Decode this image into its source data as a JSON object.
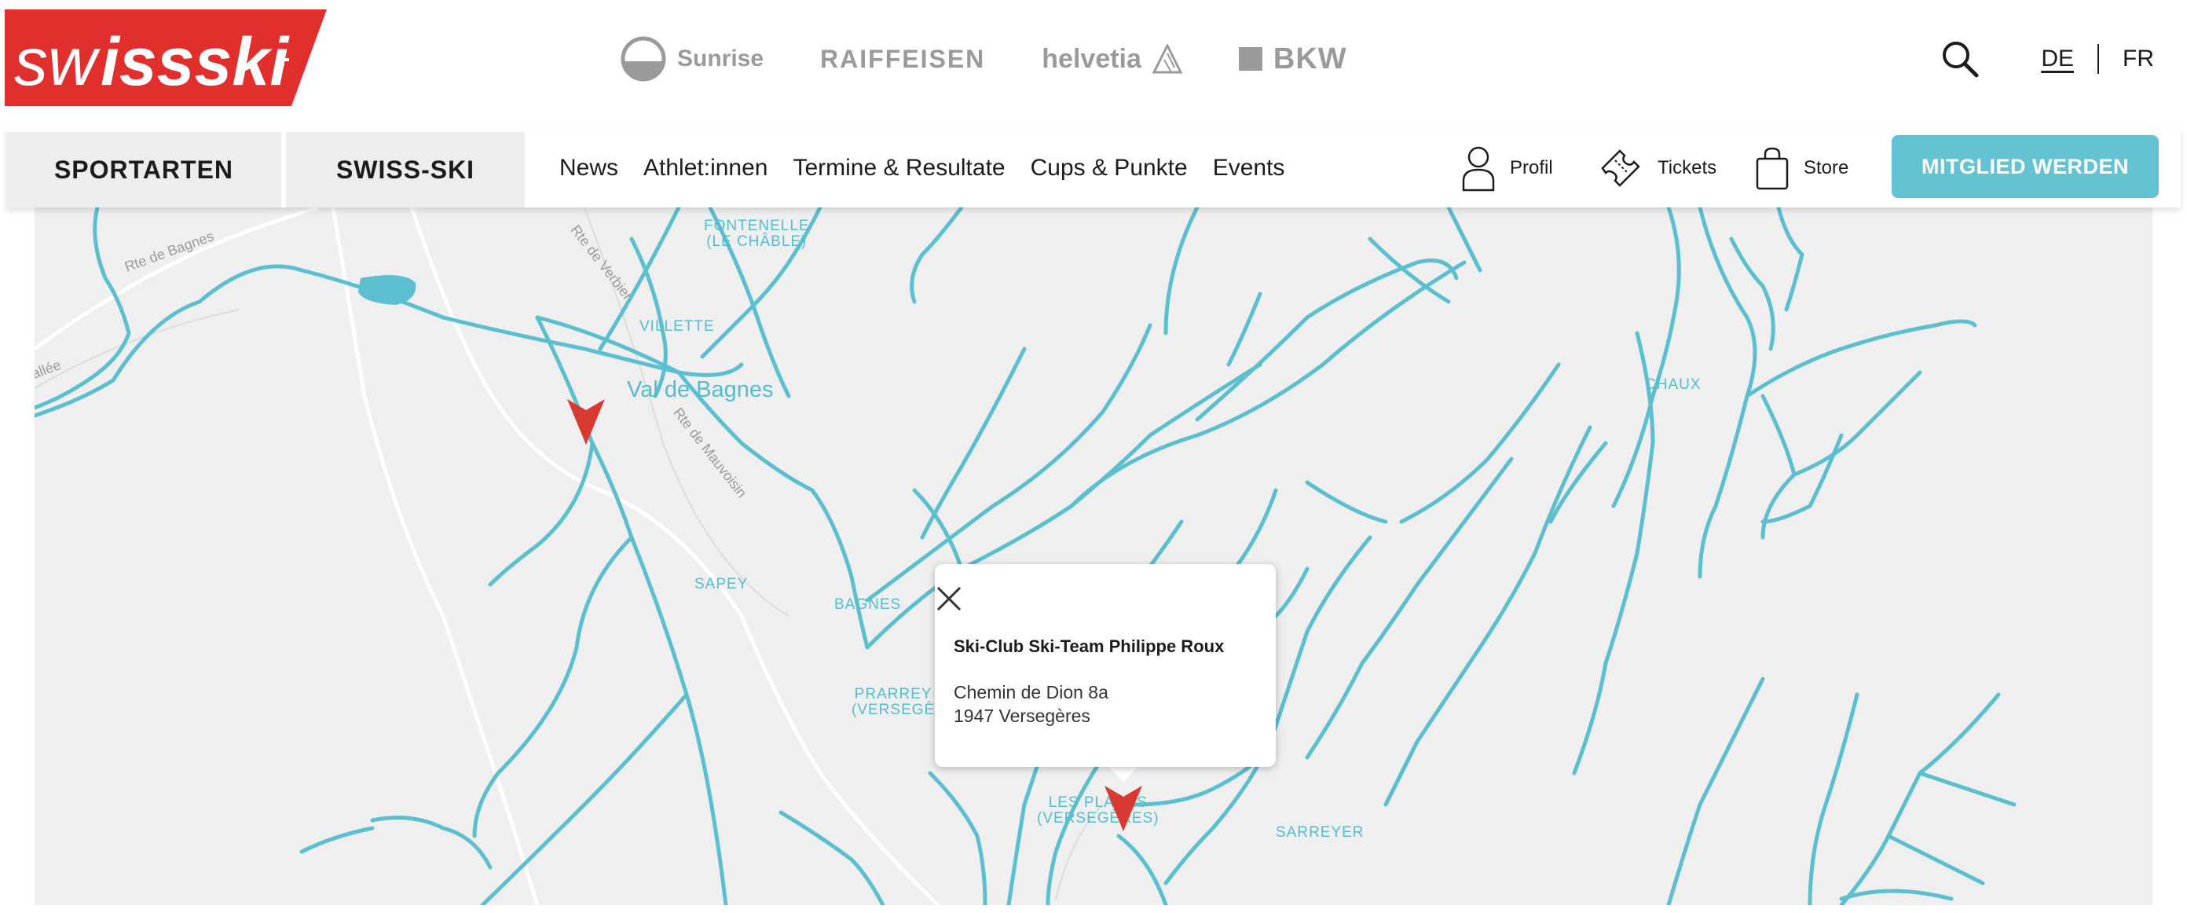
{
  "brand": {
    "logo_text": "swissski",
    "logo_color": "#e12f2d"
  },
  "sponsors": [
    "Sunrise",
    "RAIFFEISEN",
    "helvetia",
    "BKW"
  ],
  "header": {
    "languages": [
      {
        "label": "DE",
        "active": true
      },
      {
        "label": "FR",
        "active": false
      }
    ]
  },
  "nav": {
    "tabs": [
      "SPORTARTEN",
      "SWISS-SKI"
    ],
    "links": [
      "News",
      "Athlet:innen",
      "Termine & Resultate",
      "Cups & Punkte",
      "Events"
    ],
    "utility": {
      "profile": "Profil",
      "tickets": "Tickets",
      "store": "Store"
    },
    "cta": "MITGLIED WERDEN",
    "accent_color": "#64c3d3"
  },
  "map": {
    "places": {
      "fontenelle": [
        "FONTENELLE",
        "(LE CHÂBLE)"
      ],
      "villette": "VILLETTE",
      "val_de_bagnes": "Val de Bagnes",
      "chaux": "CHAUX",
      "sapey": "SAPEY",
      "bagnes": "BAGNES",
      "prarreyer": [
        "PRARREY",
        "(VERSEGÈ"
      ],
      "les_places": [
        "LES PLACES",
        "(VERSEGÈRES)"
      ],
      "sarreyer": "SARREYER"
    },
    "roads": {
      "bagnes": "Rte de Bagnes",
      "verbier": "Rte de Verbier",
      "mauvoisin": "Rte de Mauvoisin",
      "vallee": "allée"
    },
    "water_color": "#5bbfcf",
    "marker_color": "#d83a31",
    "popup": {
      "title": "Ski-Club Ski-Team Philippe Roux",
      "address_line1": "Chemin de Dion 8a",
      "address_line2": "1947 Versegères"
    }
  }
}
